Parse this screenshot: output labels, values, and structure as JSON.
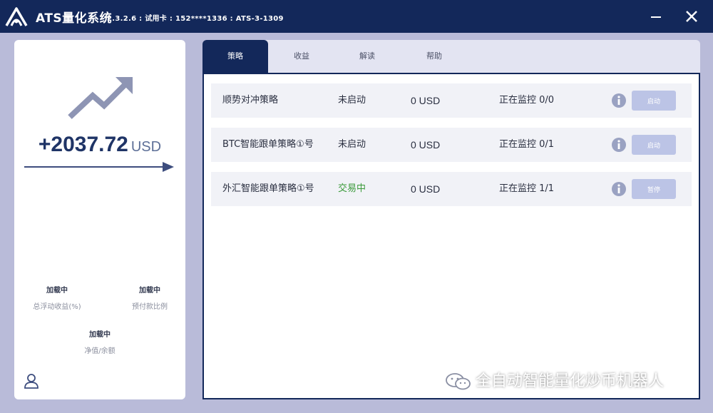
{
  "app": {
    "title": "ATS量化系统",
    "meta": "2.3.2.6 : 试用卡 : 152****1336 : ATS-3-1309"
  },
  "colors": {
    "titlebar": "#13285a",
    "accent": "#13285a",
    "running_status": "#3a9a3a",
    "button": "#bcc4e6",
    "background": "#b9bbd9"
  },
  "summary": {
    "profit_value": "+2037.72",
    "profit_unit": "USD",
    "stats": [
      {
        "value": "加载中",
        "label": "总浮动收益(%)"
      },
      {
        "value": "加载中",
        "label": "预付款比例"
      },
      {
        "value": "加载中",
        "label": "净值/余额"
      }
    ]
  },
  "tabs": [
    {
      "label": "策略",
      "active": true
    },
    {
      "label": "收益",
      "active": false
    },
    {
      "label": "解读",
      "active": false
    },
    {
      "label": "帮助",
      "active": false
    }
  ],
  "strategies": [
    {
      "name": "顺势对冲策略",
      "status": "未启动",
      "amount": "0 USD",
      "monitor": "正在监控 0/0",
      "button": "启动"
    },
    {
      "name": "BTC智能跟单策略①号",
      "status": "未启动",
      "amount": "0 USD",
      "monitor": "正在监控 0/1",
      "button": "启动"
    },
    {
      "name": "外汇智能跟单策略①号",
      "status": "交易中",
      "amount": "0 USD",
      "monitor": "正在监控 1/1",
      "button": "暂停"
    }
  ],
  "watermark": "全自动智能量化炒币机器人",
  "icons": {
    "logo": "ats-logo-icon",
    "minimize": "minimize-icon",
    "close": "close-icon",
    "trend": "trend-up-icon",
    "arrow": "arrow-right-icon",
    "user": "user-icon",
    "info": "info-icon",
    "wechat": "wechat-icon"
  }
}
